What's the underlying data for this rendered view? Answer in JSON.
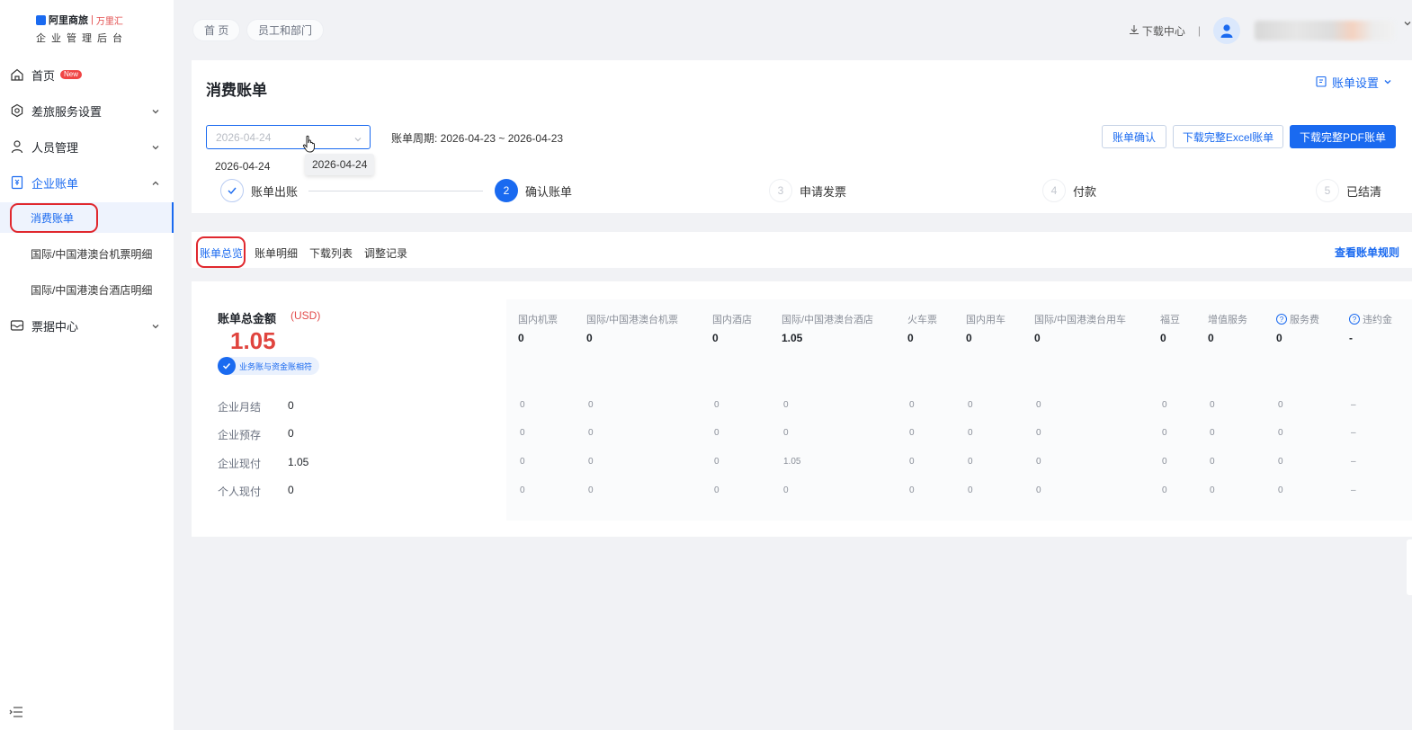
{
  "logo": {
    "brand": "阿里商旅",
    "sep": "|",
    "partner": "万里汇",
    "subtitle": "企业管理后台"
  },
  "sidebar": {
    "home": {
      "label": "首页",
      "badge": "New"
    },
    "travel": {
      "label": "差旅服务设置"
    },
    "people": {
      "label": "人员管理"
    },
    "bills": {
      "label": "企业账单",
      "children": [
        "消费账单",
        "国际/中国港澳台机票明细",
        "国际/中国港澳台酒店明细"
      ]
    },
    "invoice": {
      "label": "票据中心"
    }
  },
  "breadcrumb": [
    "首 页",
    "员工和部门"
  ],
  "topbar": {
    "download_center": "下载中心",
    "divider": "|"
  },
  "page": {
    "title": "消费账单",
    "settings_label": "账单设置",
    "date_value": "2026-04-24",
    "dropdown_option": "2026-04-24",
    "tooltip": "2026-04-24",
    "period": "账单周期: 2026-04-23 ~ 2026-04-23",
    "buttons": {
      "confirm": "账单确认",
      "excel": "下载完整Excel账单",
      "pdf": "下载完整PDF账单"
    }
  },
  "steps": [
    {
      "num": "",
      "label": "账单出账",
      "state": "done"
    },
    {
      "num": "2",
      "label": "确认账单",
      "state": "active"
    },
    {
      "num": "3",
      "label": "申请发票",
      "state": "todo"
    },
    {
      "num": "4",
      "label": "付款",
      "state": "todo"
    },
    {
      "num": "5",
      "label": "已结清",
      "state": "todo"
    }
  ],
  "tabs": [
    "账单总览",
    "账单明细",
    "下载列表",
    "调整记录"
  ],
  "rules_link": "查看账单规则",
  "summary": {
    "label": "账单总金额",
    "currency": "(USD)",
    "amount": "1.05",
    "badge": "业务账与资金账相符",
    "rows": [
      {
        "label": "企业月结",
        "value": "0"
      },
      {
        "label": "企业预存",
        "value": "0"
      },
      {
        "label": "企业现付",
        "value": "1.05"
      },
      {
        "label": "个人现付",
        "value": "0"
      }
    ]
  },
  "columns": [
    {
      "name": "国内机票",
      "total": "0",
      "cells": [
        "0",
        "0",
        "0",
        "0"
      ]
    },
    {
      "name": "国际/中国港澳台机票",
      "total": "0",
      "cells": [
        "0",
        "0",
        "0",
        "0"
      ]
    },
    {
      "name": "国内酒店",
      "total": "0",
      "cells": [
        "0",
        "0",
        "0",
        "0"
      ]
    },
    {
      "name": "国际/中国港澳台酒店",
      "total": "1.05",
      "cells": [
        "0",
        "0",
        "1.05",
        "0"
      ]
    },
    {
      "name": "火车票",
      "total": "0",
      "cells": [
        "0",
        "0",
        "0",
        "0"
      ]
    },
    {
      "name": "国内用车",
      "total": "0",
      "cells": [
        "0",
        "0",
        "0",
        "0"
      ]
    },
    {
      "name": "国际/中国港澳台用车",
      "total": "0",
      "cells": [
        "0",
        "0",
        "0",
        "0"
      ]
    },
    {
      "name": "福豆",
      "total": "0",
      "cells": [
        "0",
        "0",
        "0",
        "0"
      ]
    },
    {
      "name": "增值服务",
      "total": "0",
      "cells": [
        "0",
        "0",
        "0",
        "0"
      ]
    },
    {
      "name": "服务费",
      "total": "0",
      "cells": [
        "0",
        "0",
        "0",
        "0"
      ],
      "help": "?"
    },
    {
      "name": "违约金",
      "total": "-",
      "cells": [
        "–",
        "–",
        "–",
        "–"
      ],
      "help": "?"
    }
  ],
  "colors": {
    "accent": "#1a6af0",
    "amount_red": "#e0443e",
    "highlight_ring": "#e0282e"
  },
  "icons": [
    "home-icon",
    "settings-icon",
    "user-icon",
    "bill-icon",
    "ticket-icon",
    "download-icon",
    "edit-icon",
    "check-icon",
    "help-icon",
    "collapse-menu-icon"
  ]
}
